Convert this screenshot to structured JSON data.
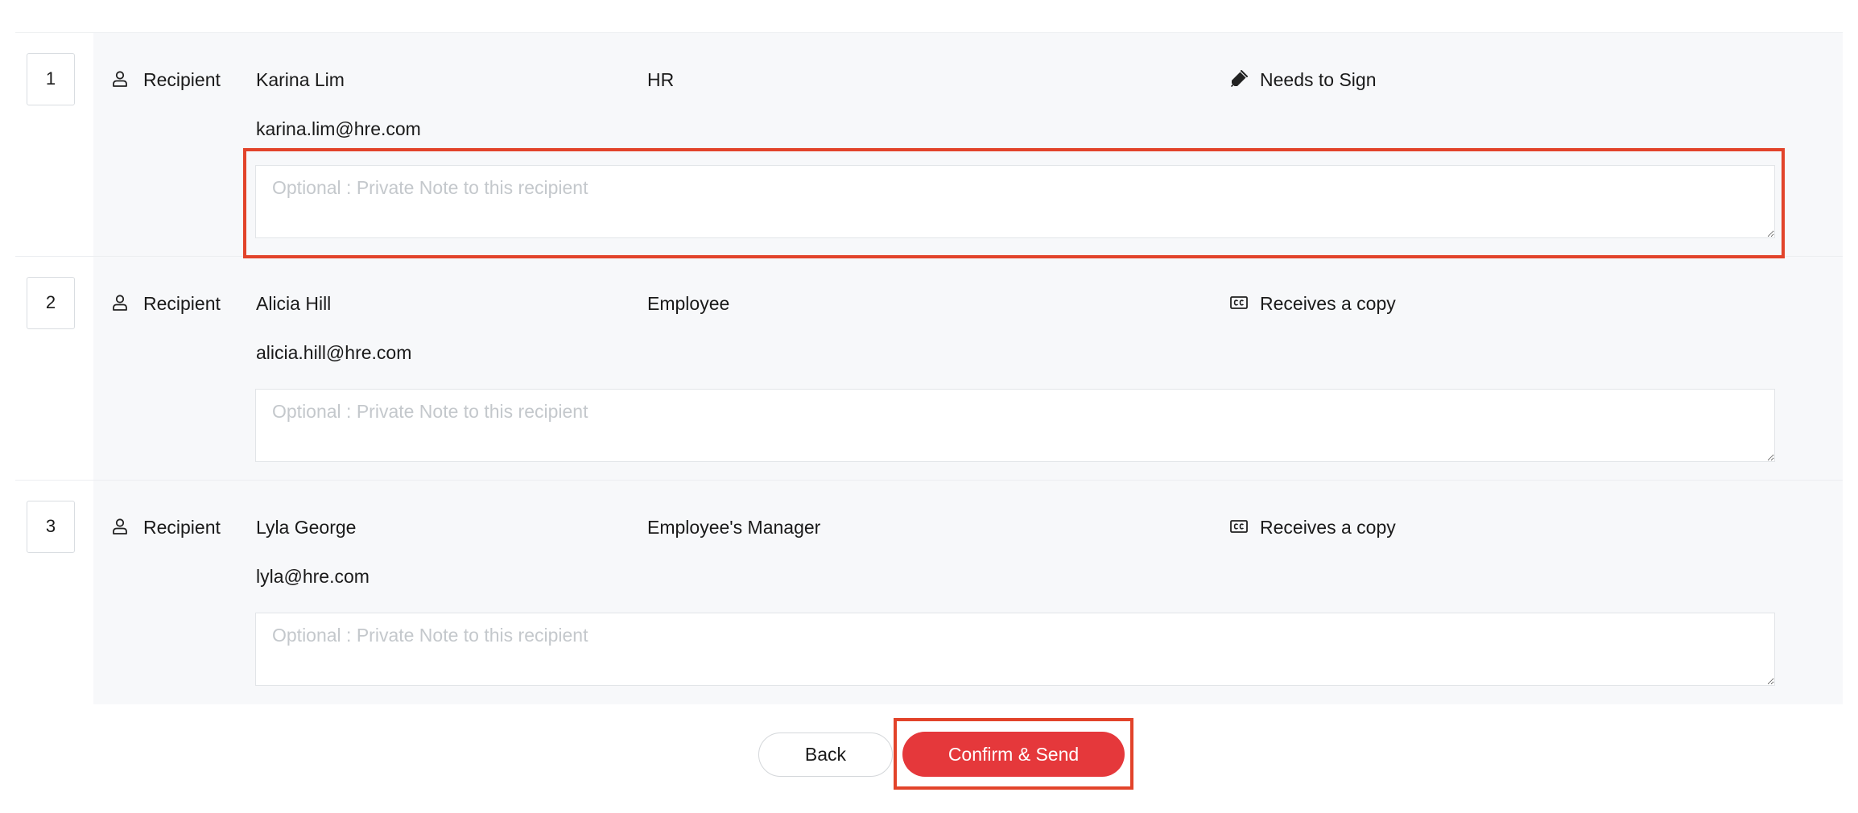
{
  "recipients": [
    {
      "order": "1",
      "type_label": "Recipient",
      "name": "Karina Lim",
      "role": "HR",
      "action_label": "Needs to Sign",
      "action_icon": "pen-icon",
      "email": "karina.lim@hre.com",
      "note_placeholder": "Optional : Private Note to this recipient",
      "note_value": ""
    },
    {
      "order": "2",
      "type_label": "Recipient",
      "name": "Alicia Hill",
      "role": "Employee",
      "action_label": "Receives a copy",
      "action_icon": "cc-icon",
      "email": "alicia.hill@hre.com",
      "note_placeholder": "Optional : Private Note to this recipient",
      "note_value": ""
    },
    {
      "order": "3",
      "type_label": "Recipient",
      "name": "Lyla George",
      "role": "Employee's Manager",
      "action_label": "Receives a copy",
      "action_icon": "cc-icon",
      "email": "lyla@hre.com",
      "note_placeholder": "Optional : Private Note to this recipient",
      "note_value": ""
    }
  ],
  "footer": {
    "back_label": "Back",
    "confirm_label": "Confirm & Send"
  },
  "colors": {
    "accent": "#e5383b",
    "highlight": "#e2432a",
    "row_background": "#f7f8fa",
    "placeholder": "#c4c8cc"
  },
  "icons": {
    "type": "user-icon",
    "sign": "pen-icon",
    "copy": "cc-icon"
  }
}
